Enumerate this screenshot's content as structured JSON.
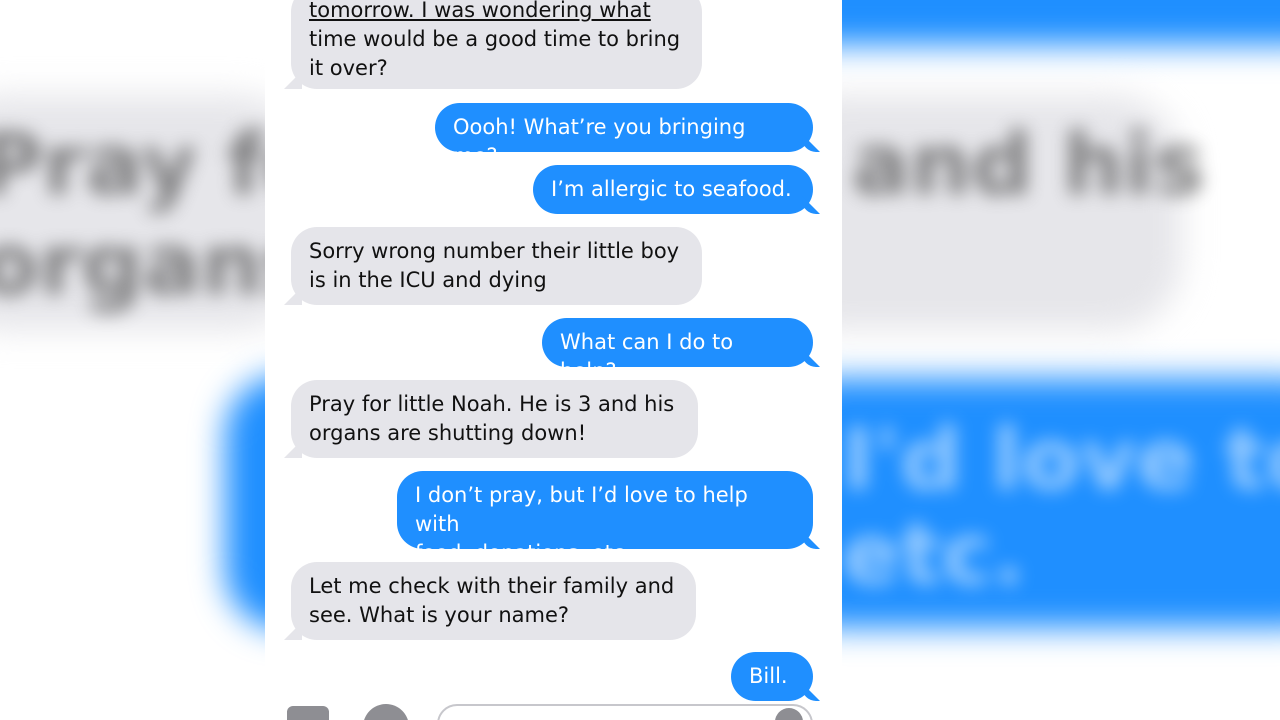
{
  "messages": [
    {
      "side": "recv",
      "lines": [
        "tomorrow. I was wondering what",
        "time would be a good time to bring",
        "it over?"
      ]
    },
    {
      "side": "sent",
      "lines": [
        "Oooh! What’re you bringing me?"
      ]
    },
    {
      "side": "sent",
      "lines": [
        "I’m allergic to seafood."
      ]
    },
    {
      "side": "recv",
      "lines": [
        "Sorry wrong number their little boy",
        "is in the ICU and dying"
      ]
    },
    {
      "side": "sent",
      "lines": [
        "What can I do to help?"
      ]
    },
    {
      "side": "recv",
      "lines": [
        "Pray for little Noah. He is 3 and his",
        "organs are shutting down!"
      ]
    },
    {
      "side": "sent",
      "lines": [
        "I don’t pray, but I’d love to help with",
        "food, donations, etc."
      ]
    },
    {
      "side": "recv",
      "lines": [
        "Let me check with their family and",
        "see. What is your name?"
      ]
    },
    {
      "side": "sent",
      "lines": [
        "Bill."
      ]
    }
  ],
  "input_bar": {
    "icons": [
      "camera-icon",
      "app-store-icon",
      "microphone-icon"
    ]
  },
  "colors": {
    "sent_bubble": "#1f8fff",
    "received_bubble": "#e5e5ea",
    "sent_text": "#ffffff",
    "received_text": "#111111"
  }
}
